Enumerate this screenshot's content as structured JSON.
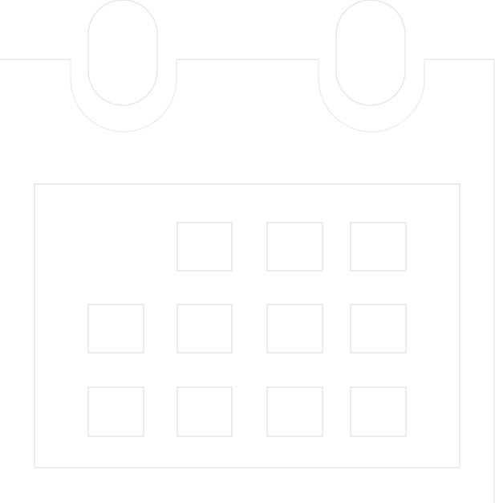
{
  "icon": {
    "name": "calendar-icon",
    "background_color": "#ffffff",
    "stroke_color": "#e9e9e9",
    "fill_color": "#ffffff"
  },
  "grid": {
    "rows": 3,
    "columns": 4,
    "empty_cells_first_row": 1
  }
}
